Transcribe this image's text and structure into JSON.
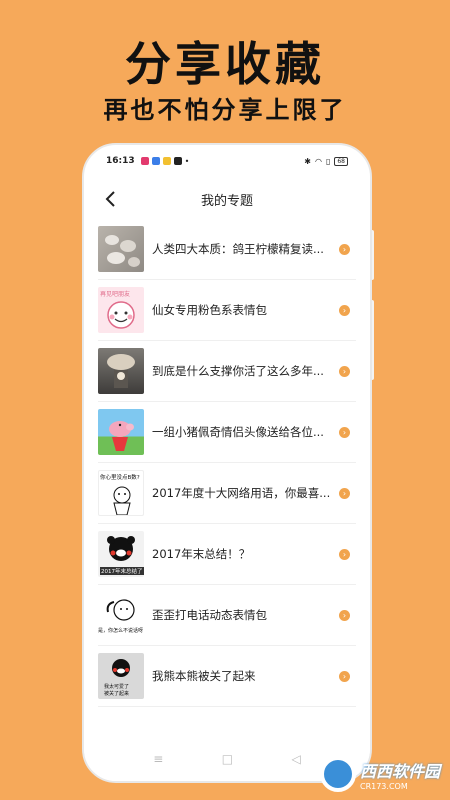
{
  "promo": {
    "title": "分享收藏",
    "subtitle": "再也不怕分享上限了"
  },
  "status_bar": {
    "time": "16:13",
    "battery": "68"
  },
  "nav": {
    "title": "我的专题"
  },
  "topics": [
    {
      "title": "人类四大本质：鸽王柠檬精复读..."
    },
    {
      "title": "仙女专用粉色系表情包"
    },
    {
      "title": "到底是什么支撑你活了这么多年..."
    },
    {
      "title": "一组小猪佩奇情侣头像送给各位..."
    },
    {
      "title": "2017年度十大网络用语，你最喜..."
    },
    {
      "title": "2017年末总结！？"
    },
    {
      "title": "歪歪打电话动态表情包"
    },
    {
      "title": "我熊本熊被关了起来"
    }
  ],
  "thumb_texts": {
    "t1": "再见吧朋友",
    "t4": "你心里没点B数?",
    "t5": "2017年末总结了",
    "t6": "是，你怎么不说话呀",
    "t7_a": "我太可爱了",
    "t7_b": "被关了起来"
  },
  "watermark": {
    "brand": "西西软件园",
    "url": "CR173.COM"
  }
}
